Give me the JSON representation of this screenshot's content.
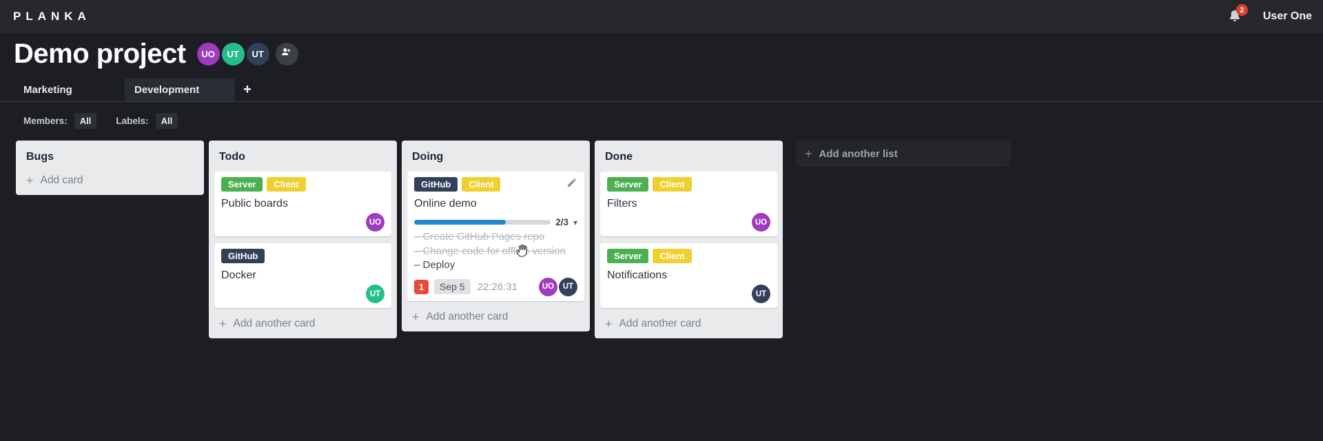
{
  "topbar": {
    "logo": "PLANKA",
    "notification_count": "2",
    "user_name": "User One"
  },
  "project": {
    "title": "Demo project",
    "members": [
      {
        "initials": "UO",
        "color": "#9e3cbe"
      },
      {
        "initials": "UT",
        "color": "#26bd8c"
      },
      {
        "initials": "UT",
        "color": "#32405a"
      }
    ]
  },
  "tabs": {
    "items": [
      {
        "label": "Marketing"
      },
      {
        "label": "Development"
      }
    ],
    "active": "Development",
    "add_label": "+"
  },
  "filterbar": {
    "members_label": "Members:",
    "members_value": "All",
    "labels_label": "Labels:",
    "labels_value": "All"
  },
  "icons": {
    "plus": "+",
    "dash": "–",
    "chevron_down": "▾"
  },
  "colors": {
    "badge_red": "#e8483a",
    "progress_blue": "#2185d0",
    "bell_badge_red": "#e03e2e"
  },
  "board": {
    "add_list_label": "Add another list",
    "lists": [
      {
        "title": "Bugs",
        "add_card_label": "Add card",
        "cards": []
      },
      {
        "title": "Todo",
        "add_card_label": "Add another card",
        "cards": [
          {
            "name": "Public boards",
            "labels": [
              {
                "text": "Server",
                "color": "#4caf50"
              },
              {
                "text": "Client",
                "color": "#f0cf2e"
              }
            ],
            "members": [
              {
                "initials": "UO",
                "color": "#9e3cbe"
              }
            ]
          },
          {
            "name": "Docker",
            "labels": [
              {
                "text": "GitHub",
                "color": "#32405a"
              }
            ],
            "members": [
              {
                "initials": "UT",
                "color": "#26bd8c"
              }
            ]
          }
        ]
      },
      {
        "title": "Doing",
        "add_card_label": "Add another card",
        "cards": [
          {
            "name": "Online demo",
            "labels": [
              {
                "text": "GitHub",
                "color": "#32405a"
              },
              {
                "text": "Client",
                "color": "#f0cf2e"
              }
            ],
            "progress": {
              "label": "2/3",
              "percent": "67%",
              "color": "#2185d0"
            },
            "tasks": [
              {
                "text": "Create GitHub Pages repo",
                "done": true
              },
              {
                "text": "Change code for offline version",
                "done": true
              },
              {
                "text": "Deploy",
                "done": false
              }
            ],
            "notification_count": "1",
            "due_date": "Sep 5",
            "timer": "22:26:31",
            "members": [
              {
                "initials": "UO",
                "color": "#9e3cbe"
              },
              {
                "initials": "UT",
                "color": "#32405a"
              }
            ]
          }
        ]
      },
      {
        "title": "Done",
        "add_card_label": "Add another card",
        "cards": [
          {
            "name": "Filters",
            "labels": [
              {
                "text": "Server",
                "color": "#4caf50"
              },
              {
                "text": "Client",
                "color": "#f0cf2e"
              }
            ],
            "members": [
              {
                "initials": "UO",
                "color": "#9e3cbe"
              }
            ]
          },
          {
            "name": "Notifications",
            "labels": [
              {
                "text": "Server",
                "color": "#4caf50"
              },
              {
                "text": "Client",
                "color": "#f0cf2e"
              }
            ],
            "members": [
              {
                "initials": "UT",
                "color": "#32405a"
              }
            ]
          }
        ]
      }
    ]
  }
}
